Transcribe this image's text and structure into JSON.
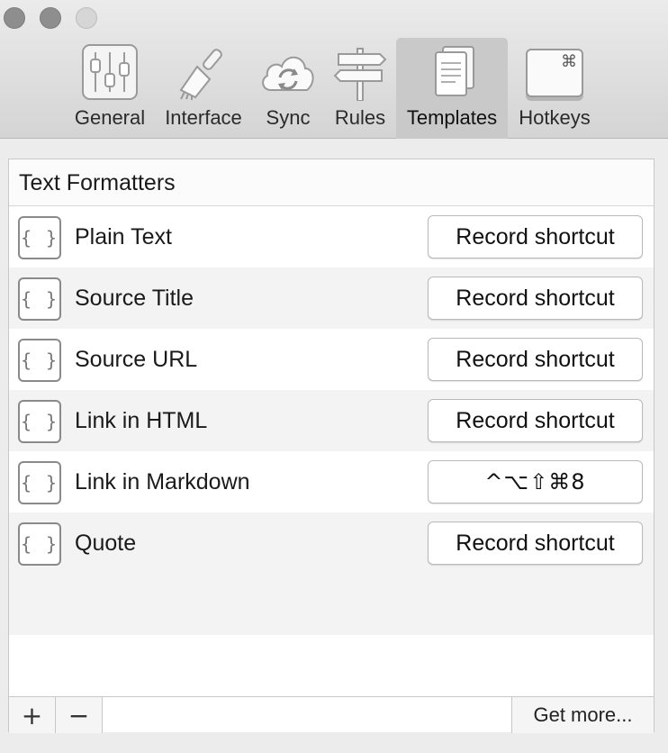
{
  "toolbar": {
    "tabs": [
      {
        "label": "General",
        "icon": "sliders-icon"
      },
      {
        "label": "Interface",
        "icon": "paintbrush-icon"
      },
      {
        "label": "Sync",
        "icon": "cloud-sync-icon"
      },
      {
        "label": "Rules",
        "icon": "signpost-icon"
      },
      {
        "label": "Templates",
        "icon": "documents-icon",
        "active": true
      },
      {
        "label": "Hotkeys",
        "icon": "command-key-icon",
        "key_glyph": "⌘"
      }
    ]
  },
  "panel": {
    "title": "Text Formatters",
    "brace_glyph": "{ }",
    "rows": [
      {
        "label": "Plain Text",
        "shortcut": "Record shortcut"
      },
      {
        "label": "Source Title",
        "shortcut": "Record shortcut"
      },
      {
        "label": "Source URL",
        "shortcut": "Record shortcut"
      },
      {
        "label": "Link in HTML",
        "shortcut": "Record shortcut"
      },
      {
        "label": "Link in Markdown",
        "shortcut": "^⌥⇧⌘8"
      },
      {
        "label": "Quote",
        "shortcut": "Record shortcut"
      }
    ]
  },
  "footer": {
    "add_label": "+",
    "remove_label": "−",
    "get_more_label": "Get more..."
  },
  "colors": {
    "toolbar_bg": "#dcdcdc",
    "active_tab_bg": "#c9c9c9",
    "row_alt": "#f3f3f3"
  }
}
